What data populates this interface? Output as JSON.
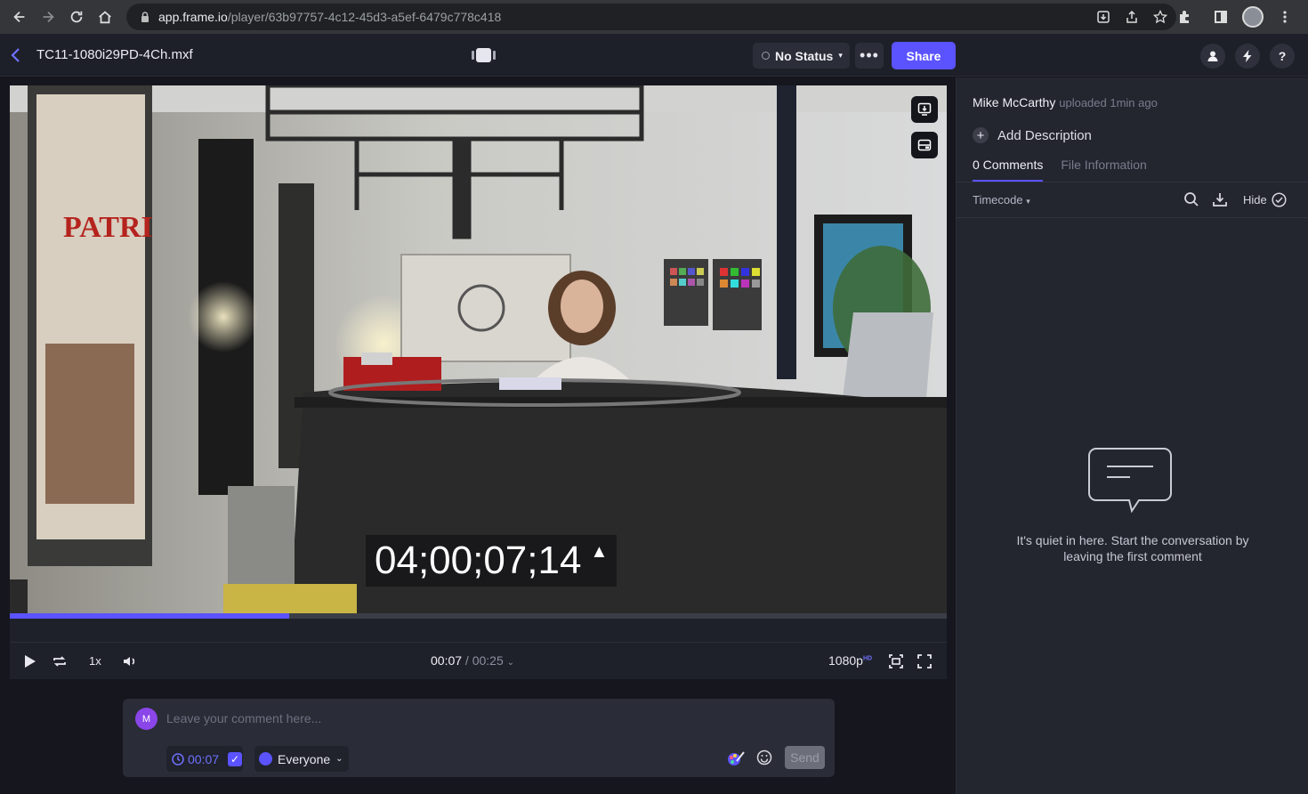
{
  "browser": {
    "url_host": "app.frame.io",
    "url_path": "/player/63b97757-4c12-45d3-a5ef-6479c778c418"
  },
  "header": {
    "file_name": "TC11-1080i29PD-4Ch.mxf",
    "status_label": "No Status",
    "more_label": "•••",
    "share_label": "Share",
    "help_label": "?"
  },
  "video": {
    "burned_timecode": "04;00;07;14",
    "progress_fraction": 0.298
  },
  "player_controls": {
    "speed": "1x",
    "current_time": "00:07",
    "separator": " / ",
    "total_time": "00:25",
    "quality": "1080p",
    "quality_badge": "HD"
  },
  "composer": {
    "avatar_initial": "M",
    "placeholder": "Leave your comment here...",
    "timestamp": "00:07",
    "audience": "Everyone",
    "send_label": "Send"
  },
  "side_panel": {
    "uploader_name": "Mike McCarthy",
    "uploader_meta": "uploaded 1min ago",
    "add_description": "Add Description",
    "tabs": [
      {
        "label": "0 Comments",
        "active": true
      },
      {
        "label": "File Information",
        "active": false
      }
    ],
    "sort_label": "Timecode",
    "hide_label": "Hide",
    "empty_line1": "It's quiet in here. Start the conversation by",
    "empty_line2": "leaving the first comment"
  },
  "colors": {
    "accent": "#5b53ff",
    "panel_bg": "#23252f",
    "app_bg": "#15161e"
  }
}
